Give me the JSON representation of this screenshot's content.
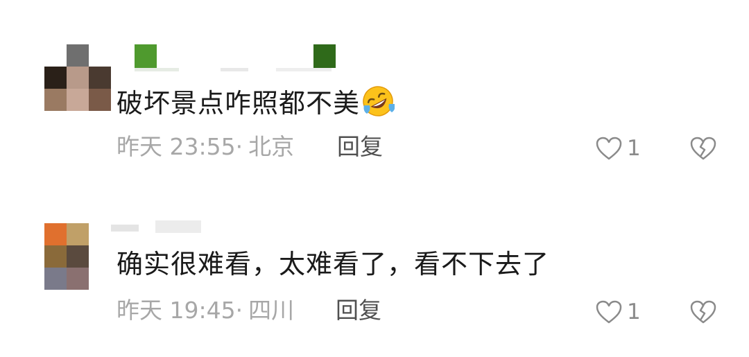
{
  "comments": [
    {
      "username": "",
      "text": "破坏景点咋照都不美",
      "emoji": "rolling-on-floor-laughing-emoji",
      "time": "昨天 23:55",
      "separator": "·",
      "location": "北京",
      "reply_label": "回复",
      "like_count": "1"
    },
    {
      "username": "",
      "text": "确实很难看，太难看了，看不下去了",
      "time": "昨天 19:45",
      "separator": "·",
      "location": "四川",
      "reply_label": "回复",
      "like_count": "1"
    }
  ],
  "colors": {
    "text": "#1a1a1a",
    "meta": "#a7a7a7",
    "reply": "#505050",
    "icon": "#8a8a8a"
  },
  "icons": {
    "like": "heart-outline-icon",
    "dislike": "broken-heart-outline-icon"
  }
}
